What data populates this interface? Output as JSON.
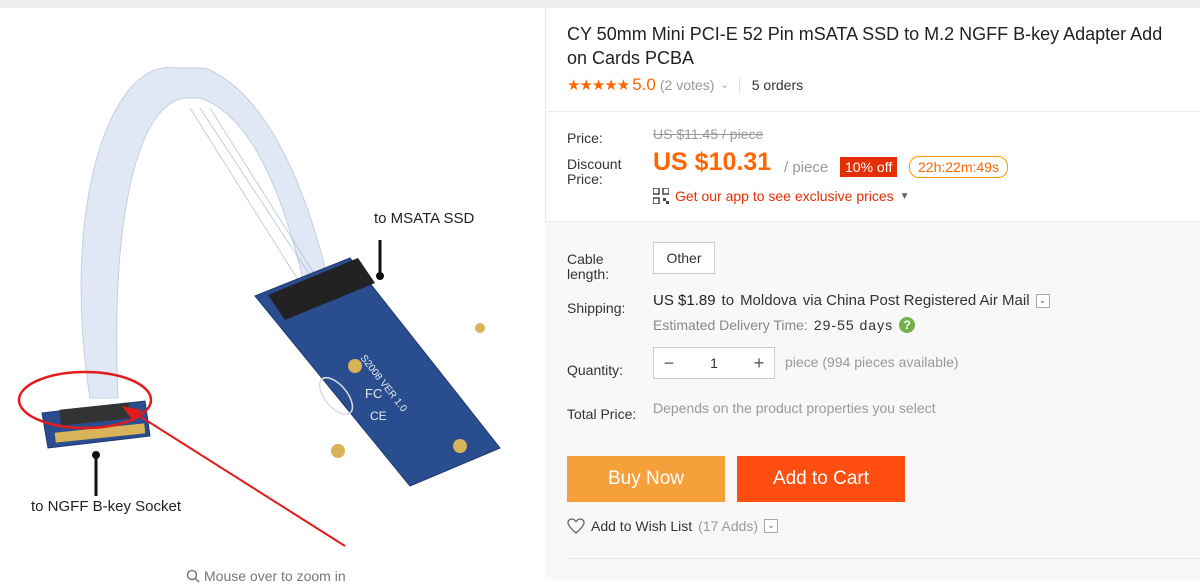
{
  "product": {
    "title": "CY 50mm Mini PCI-E 52 Pin mSATA SSD to M.2 NGFF B-key Adapter Add on Cards PCBA",
    "rating_stars": "★★★★★",
    "rating_score": "5.0",
    "votes": "(2 votes)",
    "orders": "5 orders"
  },
  "price": {
    "price_label": "Price:",
    "original": "US $11.45 / piece",
    "discount_label_1": "Discount",
    "discount_label_2": "Price:",
    "current": "US $10.31",
    "per": "/ piece",
    "off": "10% off",
    "countdown": "22h:22m:49s",
    "app_promo": "Get our app to see exclusive prices"
  },
  "options": {
    "cable_label_1": "Cable",
    "cable_label_2": "length:",
    "cable_value": "Other"
  },
  "shipping": {
    "label": "Shipping:",
    "cost": "US $1.89",
    "to": "to",
    "destination": "Moldova",
    "via": "via China Post Registered Air Mail",
    "est_label": "Estimated Delivery Time:",
    "est_days": "29-55 days"
  },
  "quantity": {
    "label": "Quantity:",
    "value": "1",
    "minus": "−",
    "plus": "+",
    "available": "piece (994 pieces available)"
  },
  "total": {
    "label": "Total Price:",
    "note": "Depends on the product properties you select"
  },
  "actions": {
    "buy_now": "Buy Now",
    "add_to_cart": "Add to Cart",
    "wish_list": "Add to Wish List",
    "wish_count": "(17 Adds)"
  },
  "gallery": {
    "zoom_hint": "Mouse over to zoom in",
    "annotation_msata": "to MSATA SSD",
    "annotation_ngff": "to NGFF B-key Socket",
    "pcb_text_1": "S2008 VER 1.0",
    "pcb_text_2": "FC",
    "pcb_text_3": "CE"
  },
  "colors": {
    "accent": "#ff6600",
    "discount_badge": "#e62e04",
    "buy_now": "#f5a03b",
    "add_to_cart": "#ff4e0f",
    "pcb_blue": "#2a4d8f"
  }
}
